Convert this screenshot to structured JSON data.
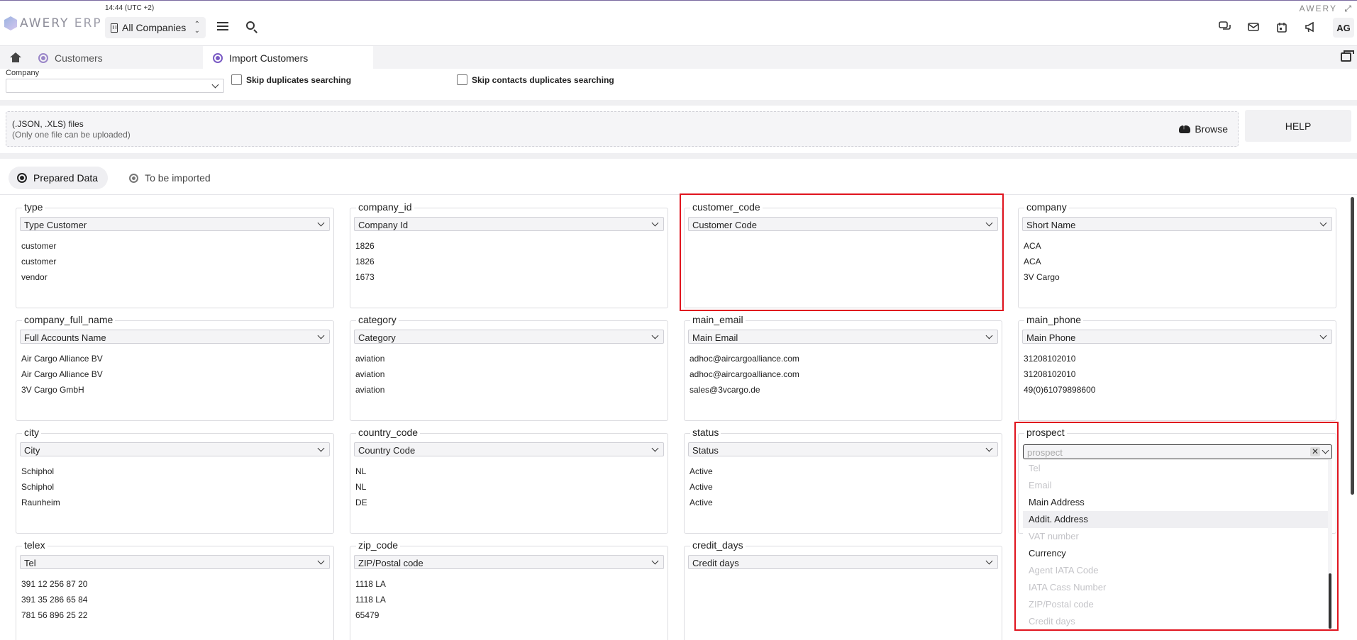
{
  "header": {
    "logo_text_1": "AWERY",
    "logo_text_2": "ERP",
    "clock": "14:44 (UTC +2)",
    "company_selector": "All Companies",
    "brand_right": "AWERY",
    "expand_glyph": "⤢",
    "avatar": "AG",
    "icons": [
      "chat-icon",
      "mail-icon",
      "calendar-icon",
      "megaphone-icon"
    ]
  },
  "tabs": {
    "customers": "Customers",
    "import_customers": "Import Customers"
  },
  "options": {
    "company_label": "Company",
    "company_value": "",
    "skip_duplicates": "Skip duplicates searching",
    "skip_contacts_duplicates": "Skip contacts duplicates searching"
  },
  "upload": {
    "title": "(.JSON, .XLS) files",
    "subtitle": "(Only one file can be uploaded)",
    "browse": "Browse",
    "help": "HELP"
  },
  "view_tabs": {
    "prepared": "Prepared Data",
    "to_import": "To be imported"
  },
  "fields": [
    {
      "label": "type",
      "mapping": "Type Customer",
      "values": [
        "customer",
        "customer",
        "vendor"
      ]
    },
    {
      "label": "company_id",
      "mapping": "Company Id",
      "values": [
        "1826",
        "1826",
        "1673"
      ]
    },
    {
      "label": "customer_code",
      "mapping": "Customer Code",
      "values": []
    },
    {
      "label": "company",
      "mapping": "Short Name",
      "values": [
        "ACA",
        "ACA",
        "3V Cargo"
      ]
    },
    {
      "label": "company_full_name",
      "mapping": "Full Accounts Name",
      "values": [
        "Air Cargo Alliance BV",
        "Air Cargo Alliance BV",
        "3V Cargo GmbH"
      ]
    },
    {
      "label": "category",
      "mapping": "Category",
      "values": [
        "aviation",
        "aviation",
        "aviation"
      ]
    },
    {
      "label": "main_email",
      "mapping": "Main Email",
      "values": [
        "adhoc@aircargoalliance.com",
        "adhoc@aircargoalliance.com",
        "sales@3vcargo.de"
      ]
    },
    {
      "label": "main_phone",
      "mapping": "Main Phone",
      "values": [
        "31208102010",
        "31208102010",
        "49(0)61079898600"
      ]
    },
    {
      "label": "city",
      "mapping": "City",
      "values": [
        "Schiphol",
        "Schiphol",
        "Raunheim"
      ]
    },
    {
      "label": "country_code",
      "mapping": "Country Code",
      "values": [
        "NL",
        "NL",
        "DE"
      ]
    },
    {
      "label": "status",
      "mapping": "Status",
      "values": [
        "Active",
        "Active",
        "Active"
      ]
    },
    {
      "label": "prospect",
      "mapping": "",
      "values": []
    },
    {
      "label": "telex",
      "mapping": "Tel",
      "values": [
        "391 12 256 87 20",
        "391 35 286 65 84",
        "781 56 896 25 22"
      ]
    },
    {
      "label": "zip_code",
      "mapping": "ZIP/Postal code",
      "values": [
        "1118 LA",
        "1118 LA",
        "65479"
      ]
    },
    {
      "label": "credit_days",
      "mapping": "Credit days",
      "values": []
    }
  ],
  "prospect_dropdown": {
    "placeholder": "prospect",
    "clear_glyph": "✕",
    "options": [
      {
        "label": "Tel",
        "disabled": true
      },
      {
        "label": "Email",
        "disabled": true
      },
      {
        "label": "Main Address",
        "disabled": false
      },
      {
        "label": "Addit. Address",
        "disabled": false,
        "highlighted": true
      },
      {
        "label": "VAT number",
        "disabled": true
      },
      {
        "label": "Currency",
        "disabled": false
      },
      {
        "label": "Agent IATA Code",
        "disabled": true
      },
      {
        "label": "IATA Cass Number",
        "disabled": true
      },
      {
        "label": "ZIP/Postal code",
        "disabled": true
      },
      {
        "label": "Credit days",
        "disabled": true
      }
    ]
  },
  "colors": {
    "accent": "#7a5bc4",
    "highlight_box": "#e0141e"
  }
}
